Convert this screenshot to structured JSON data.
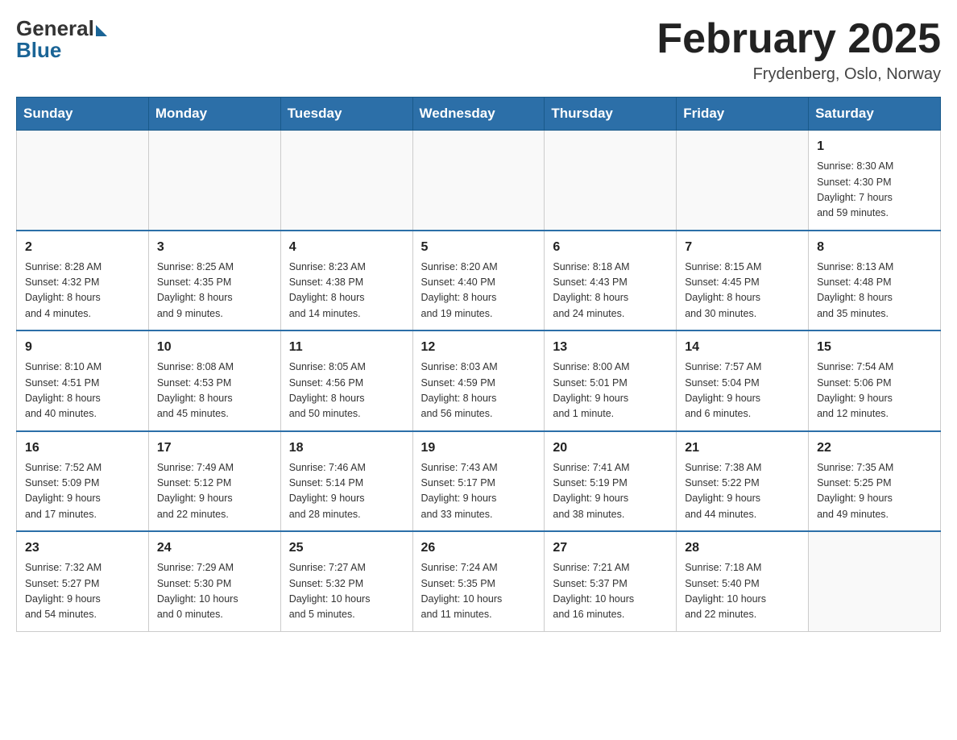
{
  "header": {
    "logo_general": "General",
    "logo_blue": "Blue",
    "title": "February 2025",
    "location": "Frydenberg, Oslo, Norway"
  },
  "days_of_week": [
    "Sunday",
    "Monday",
    "Tuesday",
    "Wednesday",
    "Thursday",
    "Friday",
    "Saturday"
  ],
  "weeks": [
    [
      {
        "day": "",
        "info": ""
      },
      {
        "day": "",
        "info": ""
      },
      {
        "day": "",
        "info": ""
      },
      {
        "day": "",
        "info": ""
      },
      {
        "day": "",
        "info": ""
      },
      {
        "day": "",
        "info": ""
      },
      {
        "day": "1",
        "info": "Sunrise: 8:30 AM\nSunset: 4:30 PM\nDaylight: 7 hours\nand 59 minutes."
      }
    ],
    [
      {
        "day": "2",
        "info": "Sunrise: 8:28 AM\nSunset: 4:32 PM\nDaylight: 8 hours\nand 4 minutes."
      },
      {
        "day": "3",
        "info": "Sunrise: 8:25 AM\nSunset: 4:35 PM\nDaylight: 8 hours\nand 9 minutes."
      },
      {
        "day": "4",
        "info": "Sunrise: 8:23 AM\nSunset: 4:38 PM\nDaylight: 8 hours\nand 14 minutes."
      },
      {
        "day": "5",
        "info": "Sunrise: 8:20 AM\nSunset: 4:40 PM\nDaylight: 8 hours\nand 19 minutes."
      },
      {
        "day": "6",
        "info": "Sunrise: 8:18 AM\nSunset: 4:43 PM\nDaylight: 8 hours\nand 24 minutes."
      },
      {
        "day": "7",
        "info": "Sunrise: 8:15 AM\nSunset: 4:45 PM\nDaylight: 8 hours\nand 30 minutes."
      },
      {
        "day": "8",
        "info": "Sunrise: 8:13 AM\nSunset: 4:48 PM\nDaylight: 8 hours\nand 35 minutes."
      }
    ],
    [
      {
        "day": "9",
        "info": "Sunrise: 8:10 AM\nSunset: 4:51 PM\nDaylight: 8 hours\nand 40 minutes."
      },
      {
        "day": "10",
        "info": "Sunrise: 8:08 AM\nSunset: 4:53 PM\nDaylight: 8 hours\nand 45 minutes."
      },
      {
        "day": "11",
        "info": "Sunrise: 8:05 AM\nSunset: 4:56 PM\nDaylight: 8 hours\nand 50 minutes."
      },
      {
        "day": "12",
        "info": "Sunrise: 8:03 AM\nSunset: 4:59 PM\nDaylight: 8 hours\nand 56 minutes."
      },
      {
        "day": "13",
        "info": "Sunrise: 8:00 AM\nSunset: 5:01 PM\nDaylight: 9 hours\nand 1 minute."
      },
      {
        "day": "14",
        "info": "Sunrise: 7:57 AM\nSunset: 5:04 PM\nDaylight: 9 hours\nand 6 minutes."
      },
      {
        "day": "15",
        "info": "Sunrise: 7:54 AM\nSunset: 5:06 PM\nDaylight: 9 hours\nand 12 minutes."
      }
    ],
    [
      {
        "day": "16",
        "info": "Sunrise: 7:52 AM\nSunset: 5:09 PM\nDaylight: 9 hours\nand 17 minutes."
      },
      {
        "day": "17",
        "info": "Sunrise: 7:49 AM\nSunset: 5:12 PM\nDaylight: 9 hours\nand 22 minutes."
      },
      {
        "day": "18",
        "info": "Sunrise: 7:46 AM\nSunset: 5:14 PM\nDaylight: 9 hours\nand 28 minutes."
      },
      {
        "day": "19",
        "info": "Sunrise: 7:43 AM\nSunset: 5:17 PM\nDaylight: 9 hours\nand 33 minutes."
      },
      {
        "day": "20",
        "info": "Sunrise: 7:41 AM\nSunset: 5:19 PM\nDaylight: 9 hours\nand 38 minutes."
      },
      {
        "day": "21",
        "info": "Sunrise: 7:38 AM\nSunset: 5:22 PM\nDaylight: 9 hours\nand 44 minutes."
      },
      {
        "day": "22",
        "info": "Sunrise: 7:35 AM\nSunset: 5:25 PM\nDaylight: 9 hours\nand 49 minutes."
      }
    ],
    [
      {
        "day": "23",
        "info": "Sunrise: 7:32 AM\nSunset: 5:27 PM\nDaylight: 9 hours\nand 54 minutes."
      },
      {
        "day": "24",
        "info": "Sunrise: 7:29 AM\nSunset: 5:30 PM\nDaylight: 10 hours\nand 0 minutes."
      },
      {
        "day": "25",
        "info": "Sunrise: 7:27 AM\nSunset: 5:32 PM\nDaylight: 10 hours\nand 5 minutes."
      },
      {
        "day": "26",
        "info": "Sunrise: 7:24 AM\nSunset: 5:35 PM\nDaylight: 10 hours\nand 11 minutes."
      },
      {
        "day": "27",
        "info": "Sunrise: 7:21 AM\nSunset: 5:37 PM\nDaylight: 10 hours\nand 16 minutes."
      },
      {
        "day": "28",
        "info": "Sunrise: 7:18 AM\nSunset: 5:40 PM\nDaylight: 10 hours\nand 22 minutes."
      },
      {
        "day": "",
        "info": ""
      }
    ]
  ]
}
